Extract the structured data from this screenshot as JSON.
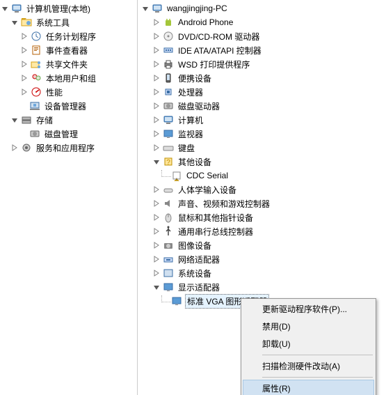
{
  "left": {
    "root": "计算机管理(本地)",
    "systools": "系统工具",
    "scheduler": "任务计划程序",
    "eventviewer": "事件查看器",
    "shared": "共享文件夹",
    "localusers": "本地用户和组",
    "perf": "性能",
    "devmgr": "设备管理器",
    "storage": "存储",
    "diskmgmt": "磁盘管理",
    "services": "服务和应用程序"
  },
  "right": {
    "pc": "wangjingjing-PC",
    "android": "Android Phone",
    "dvd": "DVD/CD-ROM 驱动器",
    "ide": "IDE ATA/ATAPI 控制器",
    "wsd": "WSD 打印提供程序",
    "portable": "便携设备",
    "cpu": "处理器",
    "disk": "磁盘驱动器",
    "computer": "计算机",
    "monitor": "监视器",
    "keyboard": "键盘",
    "other": "其他设备",
    "cdcserial": "CDC Serial",
    "hid": "人体学输入设备",
    "sound": "声音、视频和游戏控制器",
    "mouse": "鼠标和其他指针设备",
    "usb": "通用串行总线控制器",
    "imaging": "图像设备",
    "network": "网络适配器",
    "sysdev": "系统设备",
    "display": "显示适配器",
    "vga": "标准 VGA 图形适配器"
  },
  "menu": {
    "update": "更新驱动程序软件(P)...",
    "disable": "禁用(D)",
    "uninstall": "卸载(U)",
    "scan": "扫描检测硬件改动(A)",
    "props": "属性(R)"
  }
}
